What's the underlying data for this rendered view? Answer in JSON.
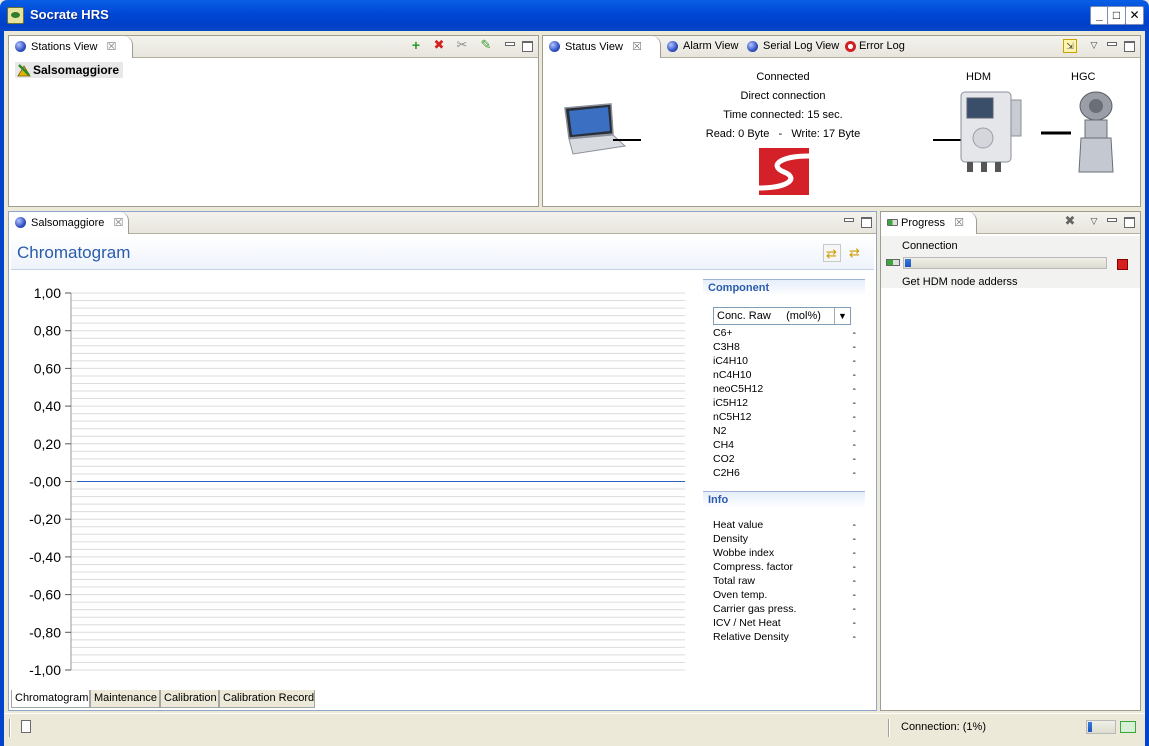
{
  "window": {
    "title": "Socrate HRS"
  },
  "stations_view": {
    "tab_label": "Stations View",
    "items": [
      {
        "label": "Salsomaggiore"
      }
    ]
  },
  "status_tabs": [
    {
      "label": "Status View"
    },
    {
      "label": "Alarm View"
    },
    {
      "label": "Serial Log View"
    },
    {
      "label": "Error Log"
    }
  ],
  "status_view": {
    "state": "Connected",
    "connection_type": "Direct connection",
    "time_connected": "Time connected: 15 sec.",
    "read_write": "Read: 0 Byte   -   Write: 17 Byte",
    "hdm_label": "HDM",
    "hgc_label": "HGC"
  },
  "editor": {
    "tab_label": "Salsomaggiore",
    "form_title": "Chromatogram",
    "component_section": "Component",
    "unit_select": "Conc. Raw     (mol%)",
    "components": [
      {
        "name": "C6+",
        "value": "-"
      },
      {
        "name": "C3H8",
        "value": "-"
      },
      {
        "name": "iC4H10",
        "value": "-"
      },
      {
        "name": "nC4H10",
        "value": "-"
      },
      {
        "name": "neoC5H12",
        "value": "-"
      },
      {
        "name": "iC5H12",
        "value": "-"
      },
      {
        "name": "nC5H12",
        "value": "-"
      },
      {
        "name": "N2",
        "value": "-"
      },
      {
        "name": "CH4",
        "value": "-"
      },
      {
        "name": "CO2",
        "value": "-"
      },
      {
        "name": "C2H6",
        "value": "-"
      }
    ],
    "info_section": "Info",
    "info": [
      {
        "name": "Heat value",
        "value": "-"
      },
      {
        "name": "Density",
        "value": "-"
      },
      {
        "name": "Wobbe index",
        "value": "-"
      },
      {
        "name": "Compress. factor",
        "value": "-"
      },
      {
        "name": "Total raw",
        "value": "-"
      },
      {
        "name": "Oven temp.",
        "value": "-"
      },
      {
        "name": "Carrier gas press.",
        "value": "-"
      },
      {
        "name": "ICV / Net Heat",
        "value": "-"
      },
      {
        "name": "Relative Density",
        "value": "-"
      }
    ],
    "bottom_tabs": [
      "Chromatogram",
      "Maintenance",
      "Calibration",
      "Calibration Record"
    ]
  },
  "chart_data": {
    "type": "line",
    "title": "",
    "xlabel": "",
    "ylabel": "",
    "ylim": [
      -1.0,
      1.0
    ],
    "yticks": [
      "1,00",
      "0,80",
      "0,60",
      "0,40",
      "0,20",
      "-0,00",
      "-0,20",
      "-0,40",
      "-0,60",
      "-0,80",
      "-1,00"
    ],
    "series": [
      {
        "values": [
          0,
          0
        ]
      }
    ],
    "grid": true,
    "line_color": "#2f5fc4"
  },
  "progress_view": {
    "tab_label": "Progress",
    "task_name": "Connection",
    "progress_fraction": 0.02,
    "subtask": "Get HDM node adderss"
  },
  "statusbar": {
    "connection_text": "Connection: (1%)",
    "progress_fraction": 0.15
  }
}
